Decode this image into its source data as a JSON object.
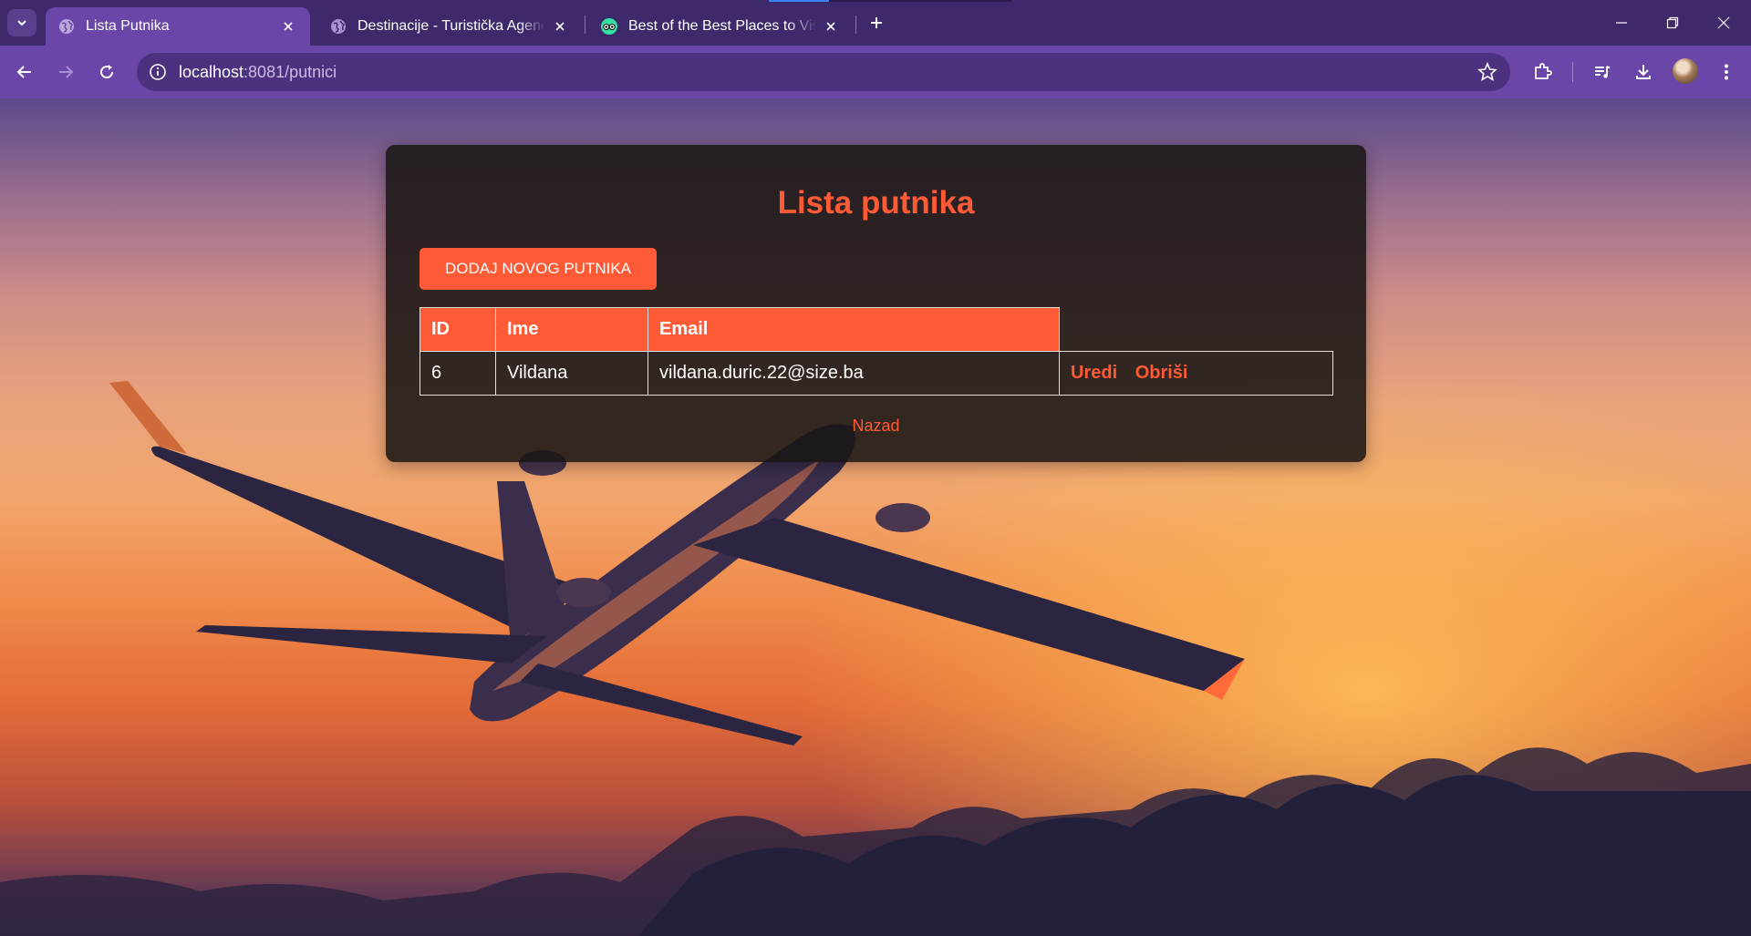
{
  "browser": {
    "tabs": [
      {
        "title": "Lista Putnika",
        "active": true,
        "favicon": "globe-icon"
      },
      {
        "title": "Destinacije - Turistička Agencija",
        "active": false,
        "favicon": "globe-icon"
      },
      {
        "title": "Best of the Best Places to Visit in",
        "active": false,
        "favicon": "tripadvisor-icon"
      }
    ],
    "url_host": "localhost",
    "url_path": ":8081/putnici"
  },
  "page": {
    "title": "Lista putnika",
    "add_button": "DODAJ NOVOG PUTNIKA",
    "table": {
      "headers": [
        "ID",
        "Ime",
        "Email"
      ],
      "rows": [
        {
          "id": "6",
          "ime": "Vildana",
          "email": "vildana.duric.22@size.ba"
        }
      ]
    },
    "actions": {
      "edit": "Uredi",
      "delete": "Obriši"
    },
    "back_link": "Nazad"
  },
  "colors": {
    "accent": "#ff5a36",
    "browser_frame": "#6a46a8",
    "panel": "#191614"
  }
}
